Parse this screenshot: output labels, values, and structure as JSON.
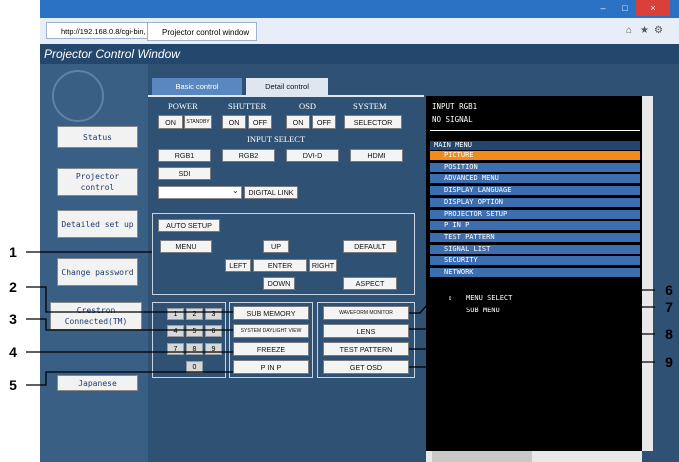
{
  "browser": {
    "url": "http://192.168.0.8/cgi-bin,",
    "tab_title": "Projector control window",
    "win_min": "–",
    "win_max": "□",
    "win_close": "×"
  },
  "app": {
    "title": "Projector Control Window",
    "tabs": [
      "Basic control",
      "Detail control"
    ]
  },
  "sidebar": {
    "status": "Status",
    "projector_control": "Projector control",
    "detailed_set_up": "Detailed set up",
    "change_password": "Change password",
    "crestron": "Crestron Connected(TM)",
    "japanese": "Japanese"
  },
  "controls": {
    "power_label": "POWER",
    "shutter_label": "SHUTTER",
    "osd_label": "OSD",
    "system_label": "SYSTEM",
    "power_on": "ON",
    "power_standby": "STANDBY",
    "shutter_on": "ON",
    "shutter_off": "OFF",
    "osd_on": "ON",
    "osd_off": "OFF",
    "selector": "SELECTOR",
    "input_select_label": "INPUT SELECT",
    "inputs": [
      "RGB1",
      "RGB2",
      "DVI-D",
      "HDMI",
      "SDI"
    ],
    "digital_link": "DIGITAL LINK",
    "auto_setup": "AUTO SETUP",
    "menu": "MENU",
    "up": "UP",
    "default": "DEFAULT",
    "left": "LEFT",
    "enter": "ENTER",
    "right": "RIGHT",
    "down": "DOWN",
    "aspect": "ASPECT",
    "numbers": [
      "1",
      "2",
      "3",
      "4",
      "5",
      "6",
      "7",
      "8",
      "9",
      "0"
    ],
    "sub_memory": "SUB MEMORY",
    "system_daylight_view": "SYSTEM DAYLIGHT VIEW",
    "freeze": "FREEZE",
    "p_in_p": "P IN P",
    "waveform_monitor": "WAVEFORM MONITOR",
    "lens": "LENS",
    "test_pattern": "TEST PATTERN",
    "get_osd": "GET OSD"
  },
  "osd": {
    "input": "INPUT RGB1",
    "signal": "NO SIGNAL",
    "menu_header": "MAIN MENU",
    "items": [
      "PICTURE",
      "POSITION",
      "ADVANCED MENU",
      "DISPLAY LANGUAGE",
      "DISPLAY OPTION",
      "PROJECTOR SETUP",
      "P IN P",
      "TEST PATTERN",
      "SIGNAL LIST",
      "SECURITY",
      "NETWORK"
    ],
    "selected_index": 0,
    "footer1": "MENU SELECT",
    "footer2": "SUB MENU"
  },
  "callouts": [
    "1",
    "2",
    "3",
    "4",
    "5",
    "6",
    "7",
    "8",
    "9"
  ],
  "colors": {
    "selected_item": "#f28a1c",
    "menu_item_bg": "#3d6fb0",
    "header_bg": "#24476e"
  }
}
